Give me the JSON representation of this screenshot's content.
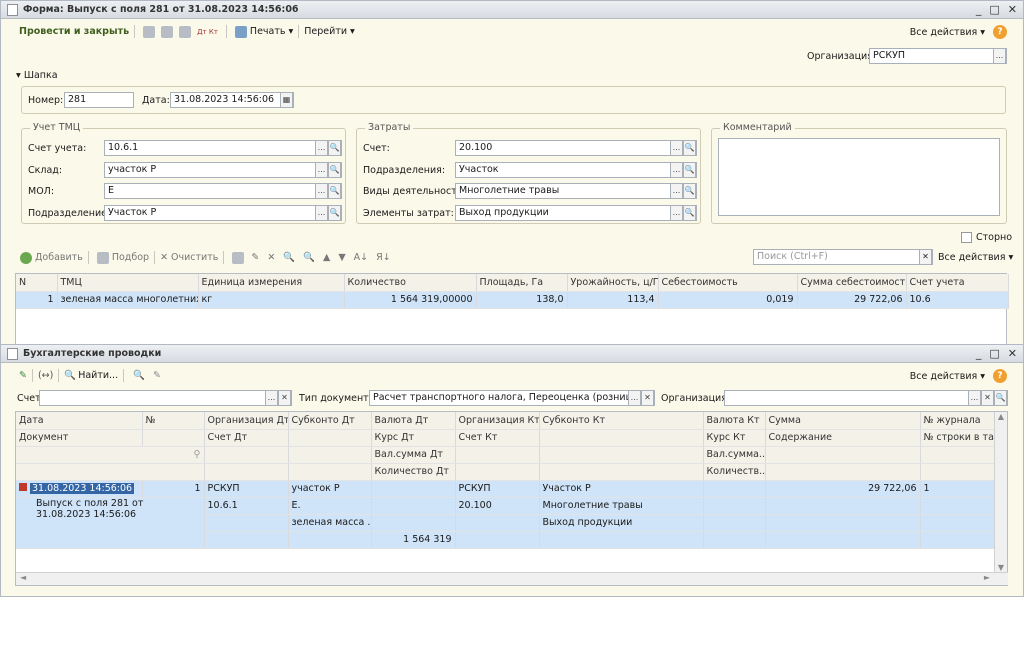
{
  "form": {
    "title": "Форма: Выпуск с поля 281 от 31.08.2023 14:56:06",
    "toolbar": {
      "post_close": "Провести и закрыть",
      "dt_kt": "Дт Кт",
      "print": "Печать",
      "goto": "Перейти",
      "all_actions": "Все действия",
      "help": "?"
    },
    "org_label": "Организация:",
    "org_value": "РСКУП",
    "header_toggle": "Шапка",
    "number_label": "Номер:",
    "number_value": "281",
    "date_label": "Дата:",
    "date_value": "31.08.2023 14:56:06",
    "uchet": {
      "title": "Учет ТМЦ",
      "account_label": "Счет учета:",
      "account_value": "10.6.1",
      "warehouse_label": "Склад:",
      "warehouse_value": "участок Р",
      "mol_label": "МОЛ:",
      "mol_value": "Е",
      "dept_label": "Подразделение:",
      "dept_value": "Участок  Р"
    },
    "costs": {
      "title": "Затраты",
      "account_label": "Счет:",
      "account_value": "20.100",
      "dept_label": "Подразделения:",
      "dept_value": "Участок",
      "activity_label": "Виды деятельности:",
      "activity_value": "Многолетние травы",
      "elements_label": "Элементы затрат:",
      "elements_value": "Выход продукции"
    },
    "comment_title": "Комментарий",
    "storno_label": "Сторно",
    "table_toolbar": {
      "add": "Добавить",
      "pick": "Подбор",
      "clear": "Очистить",
      "search_placeholder": "Поиск (Ctrl+F)",
      "all_actions": "Все действия"
    },
    "columns": [
      "N",
      "ТМЦ",
      "Единица измерения",
      "Количество",
      "Площадь, Га",
      "Урожайность, ц/Га",
      "Себестоимость",
      "Сумма себестоимости",
      "Счет учета"
    ],
    "rows": [
      [
        "1",
        "зеленая масса многолетних ...",
        "кг",
        "1 564 319,00000",
        "138,0",
        "113,4",
        "0,019",
        "29 722,06",
        "10.6"
      ]
    ]
  },
  "entries": {
    "title": "Бухгалтерские проводки",
    "toolbar": {
      "find": "Найти...",
      "all_actions": "Все действия",
      "help": "?"
    },
    "filter": {
      "account_label": "Счет:",
      "doc_type_label": "Тип документа:",
      "doc_type_value": "Расчет транспортного налога, Переоценка (розница, общ",
      "org_label": "Организация:"
    },
    "headers": {
      "row1": [
        "Дата",
        "№",
        "Организация Дт",
        "Субконто Дт",
        "Валюта Дт",
        "Организация Кт",
        "Субконто Кт",
        "Валюта Кт",
        "Сумма",
        "№ журнала"
      ],
      "row2": [
        "Документ",
        "",
        "Счет Дт",
        "",
        "Курс Дт",
        "Счет Кт",
        "",
        "Курс Кт",
        "Содержание",
        "№ строки в табл"
      ],
      "row3": [
        "",
        "",
        "",
        "",
        "Вал.сумма Дт",
        "",
        "",
        "Вал.сумма...",
        "",
        ""
      ],
      "row4": [
        "",
        "",
        "",
        "",
        "Количество Дт",
        "",
        "",
        "Количеств...",
        "",
        ""
      ]
    },
    "record": {
      "date": "31.08.2023 14:56:06",
      "num": "1",
      "org_dt": "РСКУП",
      "sub_dt_1": "участок Р",
      "org_kt": "РСКУП",
      "sub_kt_1": "Участок  Р",
      "sum": "29 722,06",
      "journal": "1",
      "document": "Выпуск с поля 281 от 31.08.2023 14:56:06",
      "acc_dt": "10.6.1",
      "sub_dt_2": "Е.",
      "acc_kt": "20.100",
      "sub_kt_2": "Многолетние травы",
      "sub_dt_3": "зеленая масса ...",
      "sub_kt_3": "Выход продукции",
      "qty_dt": "1 564 319"
    }
  }
}
